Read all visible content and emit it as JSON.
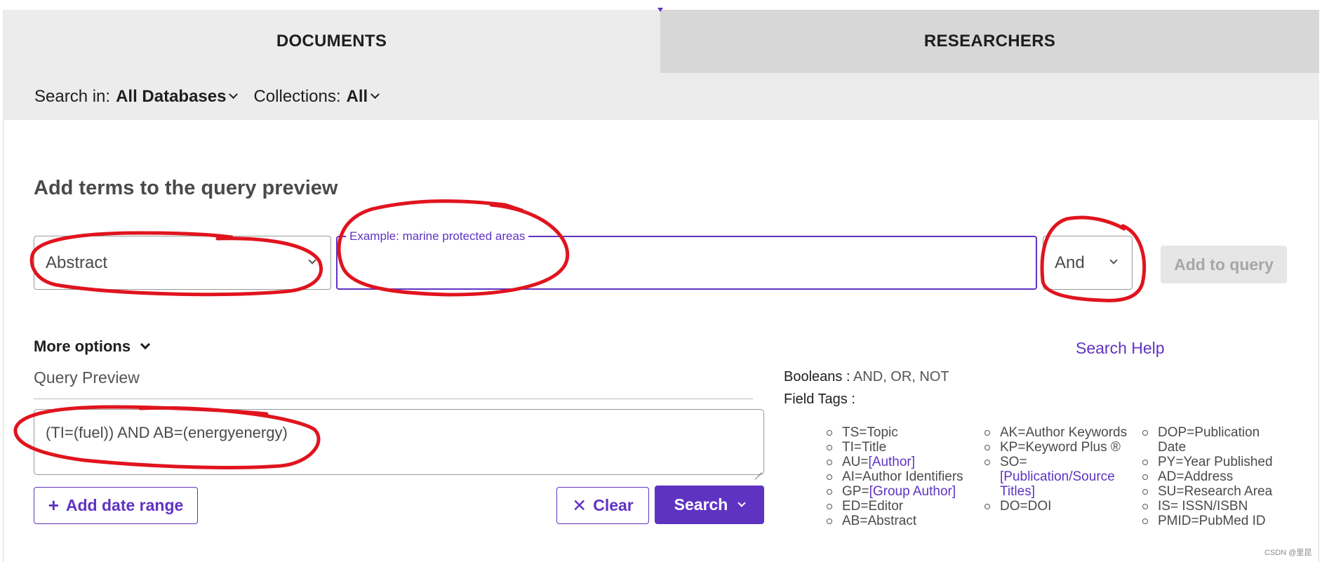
{
  "tabs": [
    {
      "label": "DOCUMENTS"
    },
    {
      "label": "RESEARCHERS"
    }
  ],
  "scope": {
    "search_in_label": "Search in:",
    "search_in_value": "All Databases",
    "collections_label": "Collections:",
    "collections_value": "All"
  },
  "builder": {
    "title": "Add terms to the query preview",
    "field_value": "Abstract",
    "term_placeholder": "Example: marine protected areas",
    "term_value": "",
    "boolean_value": "And",
    "add_button": "Add to query"
  },
  "more_options": {
    "label": "More options"
  },
  "search_help": {
    "label": "Search Help"
  },
  "query_preview": {
    "label": "Query Preview",
    "value": "(TI=(fuel)) AND AB=(energyenergy)"
  },
  "actions": {
    "date_range": "Add date range",
    "clear": "Clear",
    "search": "Search"
  },
  "help": {
    "booleans_label": "Booleans :",
    "booleans_value": "AND, OR, NOT",
    "field_tags_label": "Field Tags :",
    "columns": [
      [
        {
          "prefix": "TS=Topic",
          "link": ""
        },
        {
          "prefix": "TI=Title",
          "link": ""
        },
        {
          "prefix": "AU=",
          "link": "[Author]"
        },
        {
          "prefix": "AI=Author Identifiers",
          "link": ""
        },
        {
          "prefix": "GP=",
          "link": "[Group Author]"
        },
        {
          "prefix": "ED=Editor",
          "link": ""
        },
        {
          "prefix": "AB=Abstract",
          "link": ""
        }
      ],
      [
        {
          "prefix": "AK=Author Keywords",
          "link": ""
        },
        {
          "prefix": "KP=Keyword Plus ®",
          "link": ""
        },
        {
          "prefix": "SO=",
          "link": "[Publication/Source Titles]"
        },
        {
          "prefix": "DO=DOI",
          "link": ""
        }
      ],
      [
        {
          "prefix": "DOP=Publication Date",
          "link": ""
        },
        {
          "prefix": "PY=Year Published",
          "link": ""
        },
        {
          "prefix": "AD=Address",
          "link": ""
        },
        {
          "prefix": "SU=Research Area",
          "link": ""
        },
        {
          "prefix": "IS= ISSN/ISBN",
          "link": ""
        },
        {
          "prefix": "PMID=PubMed ID",
          "link": ""
        }
      ]
    ]
  },
  "watermark": "CSDN @里昆",
  "colors": {
    "accent": "#5f33c2",
    "annotation": "#e0141e",
    "tab_active_bg": "#ececec",
    "tab_inactive_bg": "#d7d7d7"
  }
}
